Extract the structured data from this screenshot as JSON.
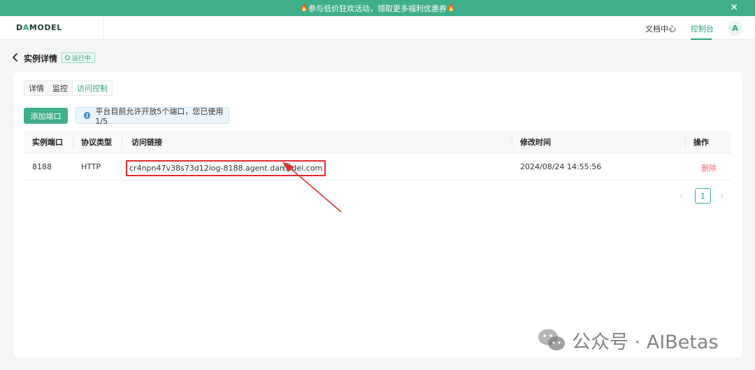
{
  "banner": {
    "text": "参与低价狂欢活动，领取更多福利优惠券",
    "fire_icon": "🔥",
    "close_icon": "✕"
  },
  "topnav": {
    "logo_prefix": "D",
    "logo_accent": "A",
    "logo_suffix": "MODEL",
    "docs_label": "文档中心",
    "console_label": "控制台",
    "avatar_letter": "A"
  },
  "page": {
    "title": "实例详情",
    "status": "运行中"
  },
  "tabs": [
    {
      "label": "详情"
    },
    {
      "label": "监控"
    },
    {
      "label": "访问控制"
    }
  ],
  "toolbar": {
    "add_label": "添加端口",
    "notice_text": "平台目前允许开放5个端口，您已使用 1/5"
  },
  "table": {
    "headers": {
      "port": "实例端口",
      "protocol": "协议类型",
      "link": "访问链接",
      "modified": "修改时间",
      "action": "操作"
    },
    "rows": [
      {
        "port": "8188",
        "protocol": "HTTP",
        "link": "cr4npn47v38s73d12iog-8188.agent.damodel.com",
        "modified": "2024/08/24 14:55:56",
        "action": "删除"
      }
    ]
  },
  "pagination": {
    "prev": "‹",
    "current": "1",
    "next": "›"
  },
  "watermark": {
    "text": "公众号 · AIBetas"
  },
  "colors": {
    "accent": "#3fae8a",
    "danger": "#f56c6c",
    "highlight": "#e22d2d"
  }
}
